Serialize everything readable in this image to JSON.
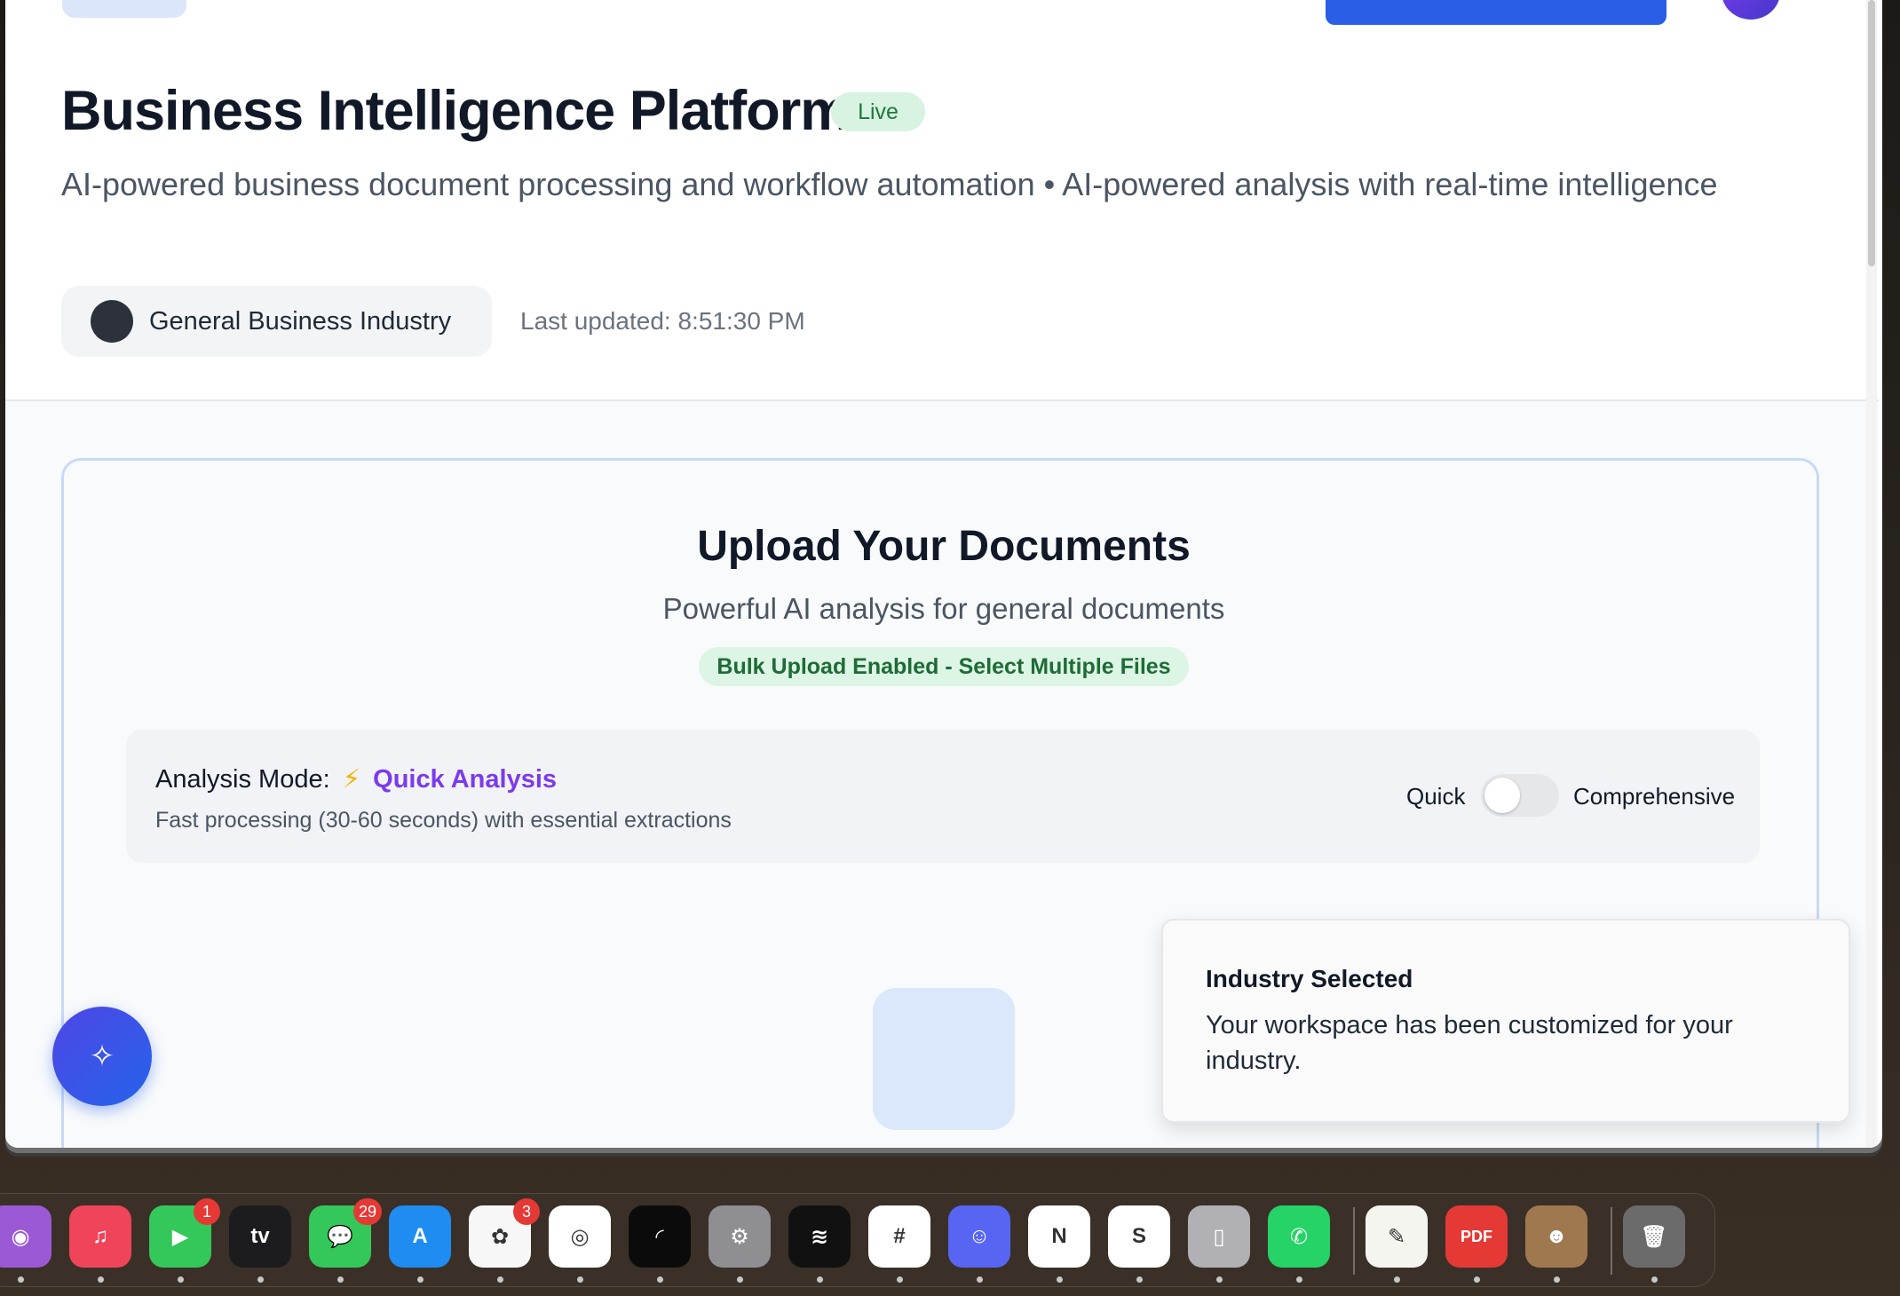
{
  "header": {
    "title": "Business Intelligence Platform",
    "status_badge": "Live",
    "subtitle": "AI-powered business document processing and workflow automation • AI-powered analysis with real-time intelligence",
    "industry_label": "General Business Industry",
    "last_updated": "Last updated: 8:51:30 PM"
  },
  "upload": {
    "title": "Upload Your Documents",
    "subtitle": "Powerful AI analysis for general documents",
    "bulk_badge": "Bulk Upload Enabled - Select Multiple Files"
  },
  "analysis_mode": {
    "label": "Analysis Mode:",
    "current": "Quick Analysis",
    "description": "Fast processing (30-60 seconds) with essential extractions",
    "toggle_left": "Quick",
    "toggle_right": "Comprehensive",
    "comprehensive_enabled": false
  },
  "toast": {
    "title": "Industry Selected",
    "body": "Your workspace has been customized for your industry."
  },
  "colors": {
    "primary": "#2a5ee6",
    "accent_purple": "#7c3aed",
    "live_green": "#1e7a3c",
    "bolt": "#f5b301"
  },
  "dock": {
    "items": [
      {
        "name": "podcasts",
        "icon": "podcasts-icon",
        "color": "#9b59d6",
        "glyph": "◉"
      },
      {
        "name": "music",
        "icon": "music-icon",
        "color": "#f0445a",
        "glyph": "♫"
      },
      {
        "name": "facetime",
        "icon": "facetime-icon",
        "color": "#34c759",
        "glyph": "▶",
        "badge": "1"
      },
      {
        "name": "tv",
        "icon": "tv-icon",
        "color": "#1c1c1e",
        "glyph": "tv"
      },
      {
        "name": "messages",
        "icon": "messages-icon",
        "color": "#34c759",
        "glyph": "💬",
        "badge": "29"
      },
      {
        "name": "app-store",
        "icon": "app-store-icon",
        "color": "#1e8cf0",
        "glyph": "A"
      },
      {
        "name": "photos",
        "icon": "photos-icon",
        "color": "#f7f7f7",
        "glyph": "✿",
        "badge": "3"
      },
      {
        "name": "chrome",
        "icon": "chrome-icon",
        "color": "#ffffff",
        "glyph": "◎"
      },
      {
        "name": "speech-app",
        "icon": "speech-app-icon",
        "color": "#0b0b0b",
        "glyph": "◜"
      },
      {
        "name": "system-settings",
        "icon": "settings-icon",
        "color": "#8e8e93",
        "glyph": "⚙"
      },
      {
        "name": "spotify",
        "icon": "spotify-icon",
        "color": "#111111",
        "glyph": "≋"
      },
      {
        "name": "slack",
        "icon": "slack-icon",
        "color": "#ffffff",
        "glyph": "#"
      },
      {
        "name": "discord",
        "icon": "discord-icon",
        "color": "#5865f2",
        "glyph": "☺"
      },
      {
        "name": "news",
        "icon": "news-icon",
        "color": "#ffffff",
        "glyph": "N"
      },
      {
        "name": "skype",
        "icon": "skype-icon",
        "color": "#ffffff",
        "glyph": "S"
      },
      {
        "name": "iphone-mirroring",
        "icon": "iphone-icon",
        "color": "#b0b0b5",
        "glyph": "▯"
      },
      {
        "name": "whatsapp",
        "icon": "whatsapp-icon",
        "color": "#25d366",
        "glyph": "✆"
      },
      {
        "name": "textedit",
        "icon": "textedit-icon",
        "color": "#f5f5f0",
        "glyph": "✎"
      },
      {
        "name": "pdf-editor",
        "icon": "pdf-icon",
        "color": "#e53935",
        "glyph": "PDF"
      },
      {
        "name": "contacts",
        "icon": "contacts-icon",
        "color": "#a07850",
        "glyph": "☻"
      },
      {
        "name": "trash",
        "icon": "trash-icon",
        "color": "#6b6b6b",
        "glyph": "🗑"
      }
    ]
  }
}
